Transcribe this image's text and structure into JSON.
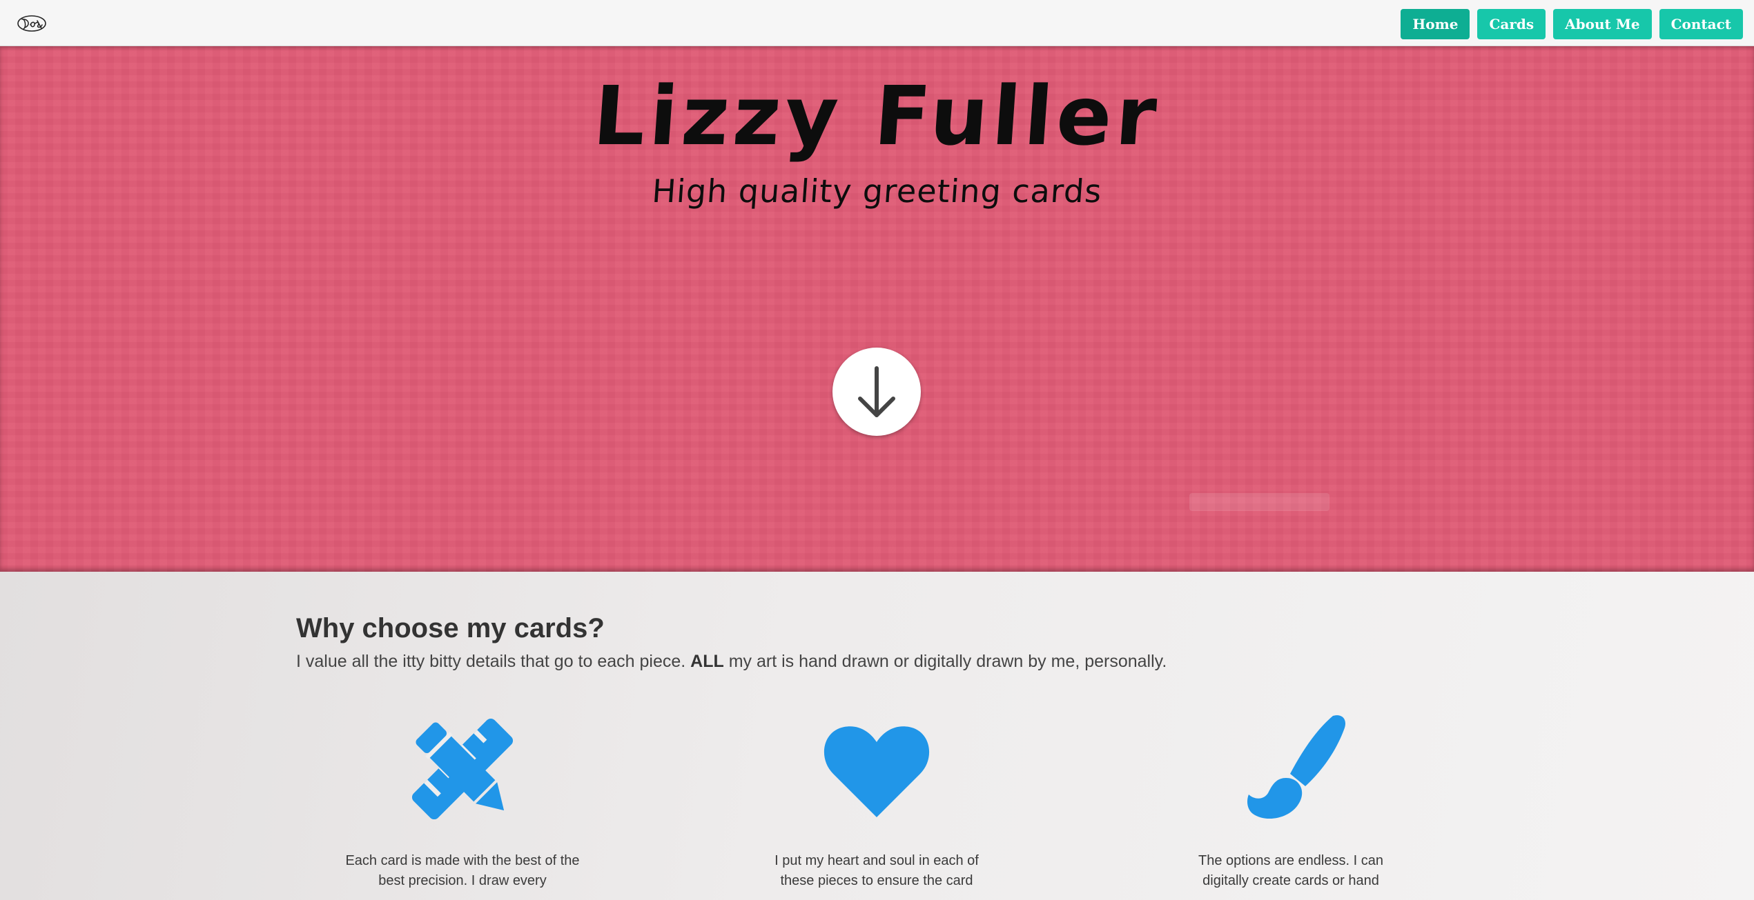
{
  "navbar": {
    "logo_icon": "signature-logo-icon",
    "links": [
      {
        "label": "Home",
        "active": true
      },
      {
        "label": "Cards",
        "active": false
      },
      {
        "label": "About Me",
        "active": false
      },
      {
        "label": "Contact",
        "active": false
      }
    ],
    "accent_color": "#17c7aa"
  },
  "hero": {
    "title": "Lizzy Fuller",
    "subtitle": "High quality greeting cards",
    "background_color": "#e05c76",
    "scroll_icon": "arrow-down-icon"
  },
  "features": {
    "title": "Why choose my cards?",
    "intro_before": "I value all the itty bitty details that go to each piece. ",
    "intro_bold": "ALL",
    "intro_after": " my art is hand drawn or digitally drawn by me, personally.",
    "icon_color": "#2196e8",
    "items": [
      {
        "icon": "pencil-ruler-icon",
        "text": "Each card is made with the best of the best precision. I draw every"
      },
      {
        "icon": "heart-icon",
        "text": "I put my heart and soul in each of these pieces to ensure the card"
      },
      {
        "icon": "paint-brush-icon",
        "text": "The options are endless. I can digitally create cards or hand"
      }
    ]
  }
}
